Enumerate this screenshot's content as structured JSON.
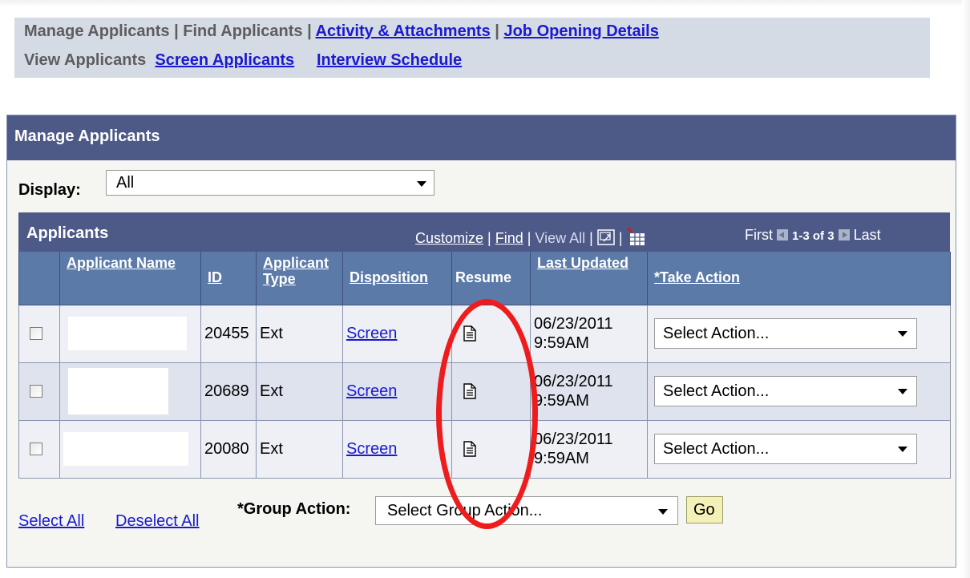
{
  "nav": {
    "row1": [
      {
        "label": "Manage Applicants",
        "link": false
      },
      {
        "label": "Find Applicants",
        "link": false
      },
      {
        "label": "Activity & Attachments",
        "link": true
      },
      {
        "label": "Job Opening Details",
        "link": true
      }
    ],
    "row2": [
      {
        "label": "View Applicants",
        "link": false
      },
      {
        "label": "Screen Applicants",
        "link": true
      },
      {
        "label": "Interview Schedule",
        "link": true
      }
    ],
    "separator": "|"
  },
  "panel": {
    "title": "Manage Applicants",
    "display_label": "Display:",
    "display_value": "All"
  },
  "grid": {
    "title": "Applicants",
    "tools": {
      "customize": "Customize",
      "find": "Find",
      "view_all": "View All"
    },
    "pager": {
      "first": "First",
      "range": "1-3 of 3",
      "last": "Last"
    },
    "columns": {
      "applicant_name": "Applicant Name",
      "id": "ID",
      "applicant_type": "Applicant Type",
      "disposition": "Disposition",
      "resume": "Resume",
      "last_updated": "Last Updated",
      "take_action": "*Take Action"
    },
    "rows": [
      {
        "id": "20455",
        "type": "Ext",
        "disposition": "Screen",
        "date": "06/23/2011",
        "time": "9:59AM",
        "action": "Select Action..."
      },
      {
        "id": "20689",
        "type": "Ext",
        "disposition": "Screen",
        "date": "06/23/2011",
        "time": "9:59AM",
        "action": "Select Action..."
      },
      {
        "id": "20080",
        "type": "Ext",
        "disposition": "Screen",
        "date": "06/23/2011",
        "time": "9:59AM",
        "action": "Select Action..."
      }
    ]
  },
  "footer": {
    "select_all": "Select All",
    "deselect_all": "Deselect All",
    "group_action_label": "*Group Action:",
    "group_action_value": "Select Group Action...",
    "go": "Go"
  },
  "colors": {
    "header_bg": "#4d5a88",
    "column_header_bg": "#5b7aa8",
    "link": "#1a1ad0",
    "annotation": "#ee1c1c",
    "go_button": "#f3f0b8"
  },
  "icons": [
    "resume-document-icon",
    "new-window-icon",
    "download-grid-icon",
    "dropdown-caret-icon"
  ]
}
